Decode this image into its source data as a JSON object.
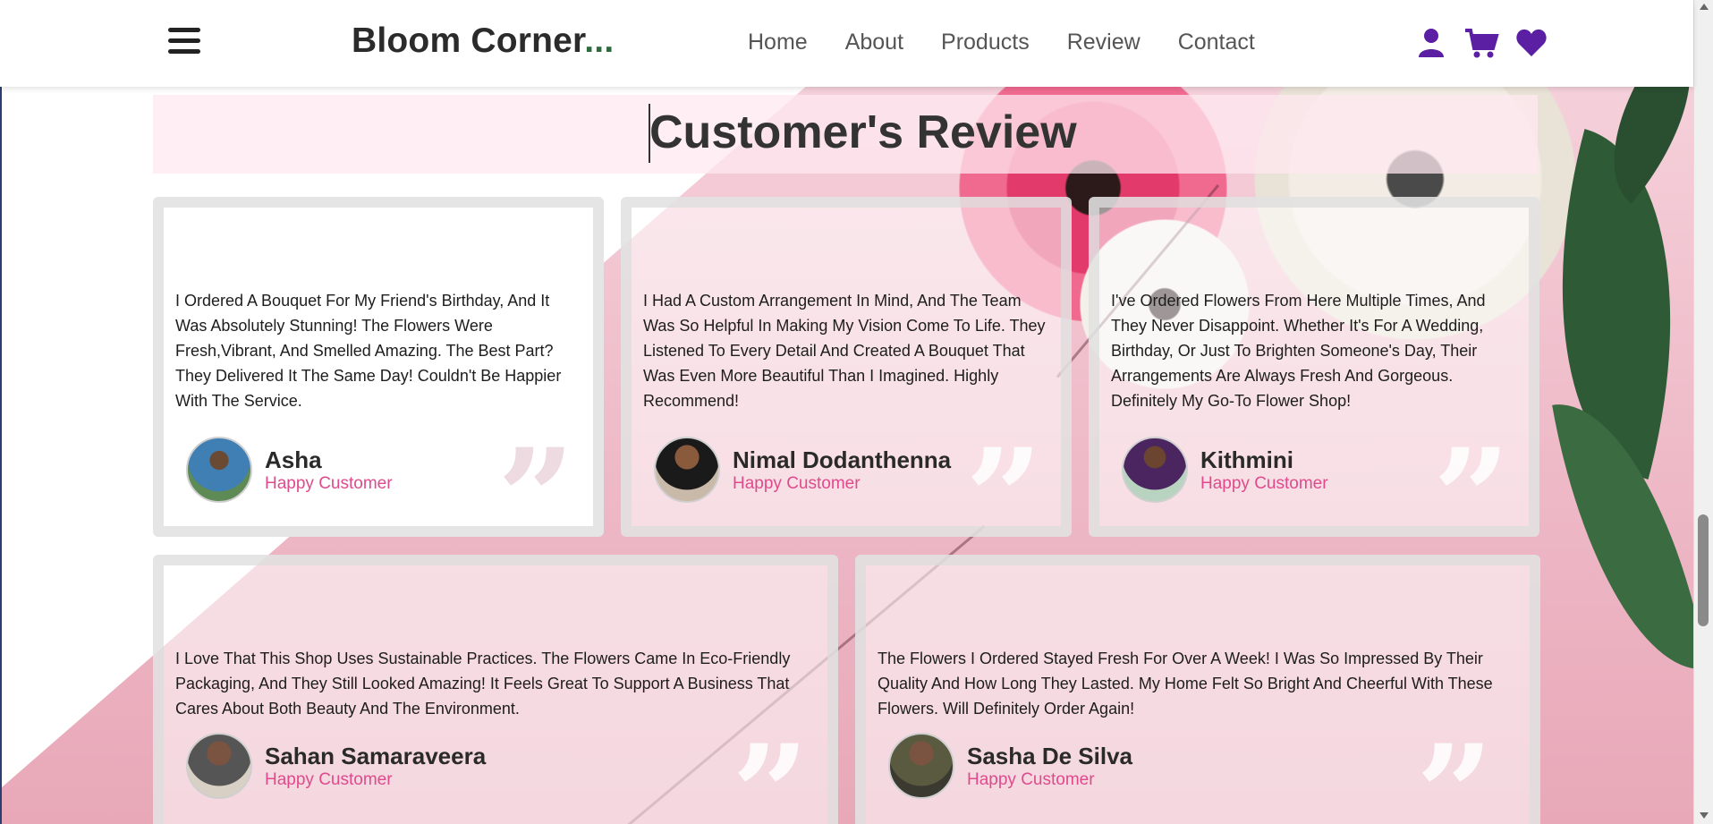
{
  "header": {
    "brand": "Bloom Corner",
    "brand_dots": "...",
    "nav": [
      "Home",
      "About",
      "Products",
      "Review",
      "Contact"
    ],
    "icons": [
      "user-icon",
      "cart-icon",
      "heart-icon"
    ],
    "accent_color": "#5b1fa3"
  },
  "section": {
    "title": "Customer's Review"
  },
  "reviews": [
    {
      "text": "I Ordered A Bouquet For My Friend's Birthday, And It Was Absolutely Stunning! The Flowers Were Fresh,Vibrant, And Smelled Amazing. The Best Part? They Delivered It The Same Day! Couldn't Be Happier With The Service.",
      "name": "Asha",
      "role": "Happy Customer"
    },
    {
      "text": "I Had A Custom Arrangement In Mind, And The Team Was So Helpful In Making My Vision Come To Life. They Listened To Every Detail And Created A Bouquet That Was Even More Beautiful Than I Imagined. Highly Recommend!",
      "name": "Nimal Dodanthenna",
      "role": "Happy Customer"
    },
    {
      "text": "I've Ordered Flowers From Here Multiple Times, And They Never Disappoint. Whether It's For A Wedding, Birthday, Or Just To Brighten Someone's Day, Their Arrangements Are Always Fresh And Gorgeous. Definitely My Go-To Flower Shop!",
      "name": "Kithmini",
      "role": "Happy Customer"
    },
    {
      "text": "I Love That This Shop Uses Sustainable Practices. The Flowers Came In Eco-Friendly Packaging, And They Still Looked Amazing! It Feels Great To Support A Business That Cares About Both Beauty And The Environment.",
      "name": "Sahan Samaraveera",
      "role": "Happy Customer"
    },
    {
      "text": "The Flowers I Ordered Stayed Fresh For Over A Week! I Was So Impressed By Their Quality And How Long They Lasted. My Home Felt So Bright And Cheerful With These Flowers. Will Definitely Order Again!",
      "name": "Sasha De Silva",
      "role": "Happy Customer"
    }
  ],
  "colors": {
    "role_pink": "#e04a8c",
    "brand_green": "#2d6a3e"
  }
}
